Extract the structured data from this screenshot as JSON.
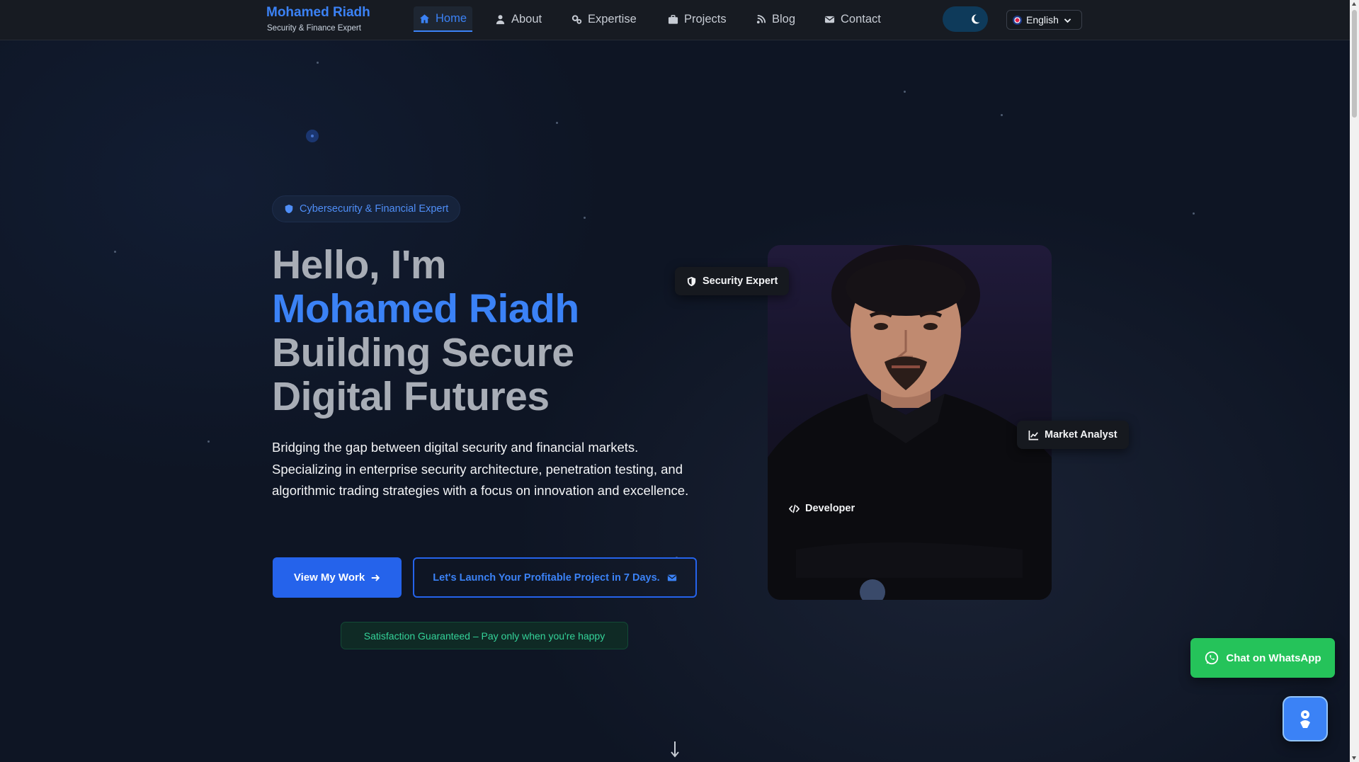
{
  "nav": {
    "brand_name": "Mohamed Riadh",
    "brand_sub": "Security & Finance Expert",
    "items": [
      {
        "label": "Home",
        "icon": "home-icon",
        "active": true
      },
      {
        "label": "About",
        "icon": "user-icon"
      },
      {
        "label": "Expertise",
        "icon": "gears-icon"
      },
      {
        "label": "Projects",
        "icon": "briefcase-icon"
      },
      {
        "label": "Blog",
        "icon": "blog-icon"
      },
      {
        "label": "Contact",
        "icon": "envelope-icon"
      }
    ],
    "theme_icon": "moon-icon",
    "language": "English"
  },
  "hero": {
    "badge": "Cybersecurity & Financial Expert",
    "title_line1": "Hello, I'm",
    "title_name": "Mohamed Riadh",
    "title_line3": "Building Secure",
    "title_line4": "Digital Futures",
    "description": "Bridging the gap between digital security and financial markets. Specializing in enterprise security architecture, penetration testing, and algorithmic trading strategies with a focus on innovation and excellence.",
    "primary_button": "View My Work",
    "secondary_button": "Let's Launch Your Profitable Project in 7 Days.",
    "guarantee": "Satisfaction Guaranteed – Pay only when you're happy"
  },
  "photo_tags": {
    "security": "Security Expert",
    "market": "Market Analyst",
    "developer": "Developer"
  },
  "floating": {
    "whatsapp": "Chat on WhatsApp"
  },
  "colors": {
    "accent": "#3b82f6",
    "background": "#0e1524",
    "navbar": "#171b22",
    "whatsapp": "#25c35a",
    "guarantee_text": "#34d399"
  }
}
